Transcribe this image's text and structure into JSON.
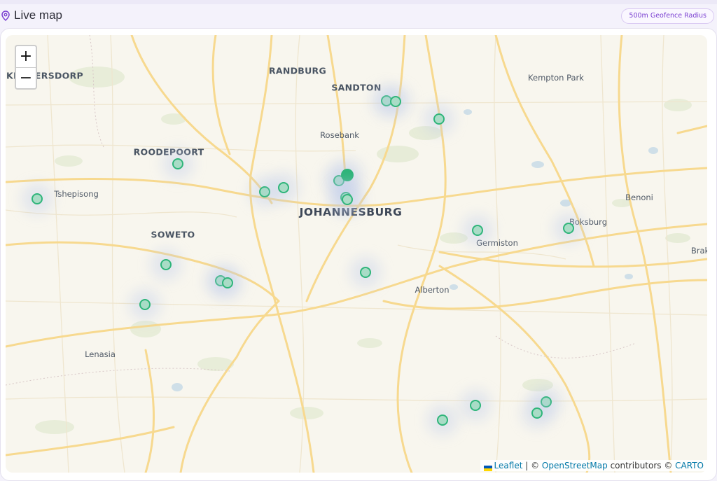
{
  "header": {
    "title": "Live map",
    "badge": "500m Geofence Radius"
  },
  "zoom": {
    "in_label": "+",
    "out_label": "−"
  },
  "places": [
    {
      "id": "krugersdorp",
      "text": "KRUGERSDORP",
      "kind": "city"
    },
    {
      "id": "randburg",
      "text": "RANDBURG",
      "kind": "city"
    },
    {
      "id": "sandton",
      "text": "SANDTON",
      "kind": "city"
    },
    {
      "id": "kempton-park",
      "text": "Kempton Park",
      "kind": "town"
    },
    {
      "id": "rosebank",
      "text": "Rosebank",
      "kind": "town"
    },
    {
      "id": "roodepoort",
      "text": "ROODEPOORT",
      "kind": "city"
    },
    {
      "id": "tshepisong",
      "text": "Tshepisong",
      "kind": "town"
    },
    {
      "id": "johannesburg",
      "text": "JOHANNESBURG",
      "kind": "major"
    },
    {
      "id": "benoni",
      "text": "Benoni",
      "kind": "town"
    },
    {
      "id": "soweto",
      "text": "SOWETO",
      "kind": "city"
    },
    {
      "id": "boksburg",
      "text": "Boksburg",
      "kind": "town"
    },
    {
      "id": "germiston",
      "text": "Germiston",
      "kind": "town"
    },
    {
      "id": "brakpan",
      "text": "Brak",
      "kind": "town"
    },
    {
      "id": "alberton",
      "text": "Alberton",
      "kind": "town"
    },
    {
      "id": "lenasia",
      "text": "Lenasia",
      "kind": "town"
    }
  ],
  "attribution": {
    "leaflet": "Leaflet",
    "sep": " | © ",
    "osm": "OpenStreetMap",
    "contributors": " contributors © ",
    "carto": "CARTO"
  },
  "colors": {
    "marker_fill": "#a9dcc6",
    "marker_stroke": "#2fb57a",
    "road": "#f7d98f",
    "badge_text": "#7a3fd1"
  }
}
